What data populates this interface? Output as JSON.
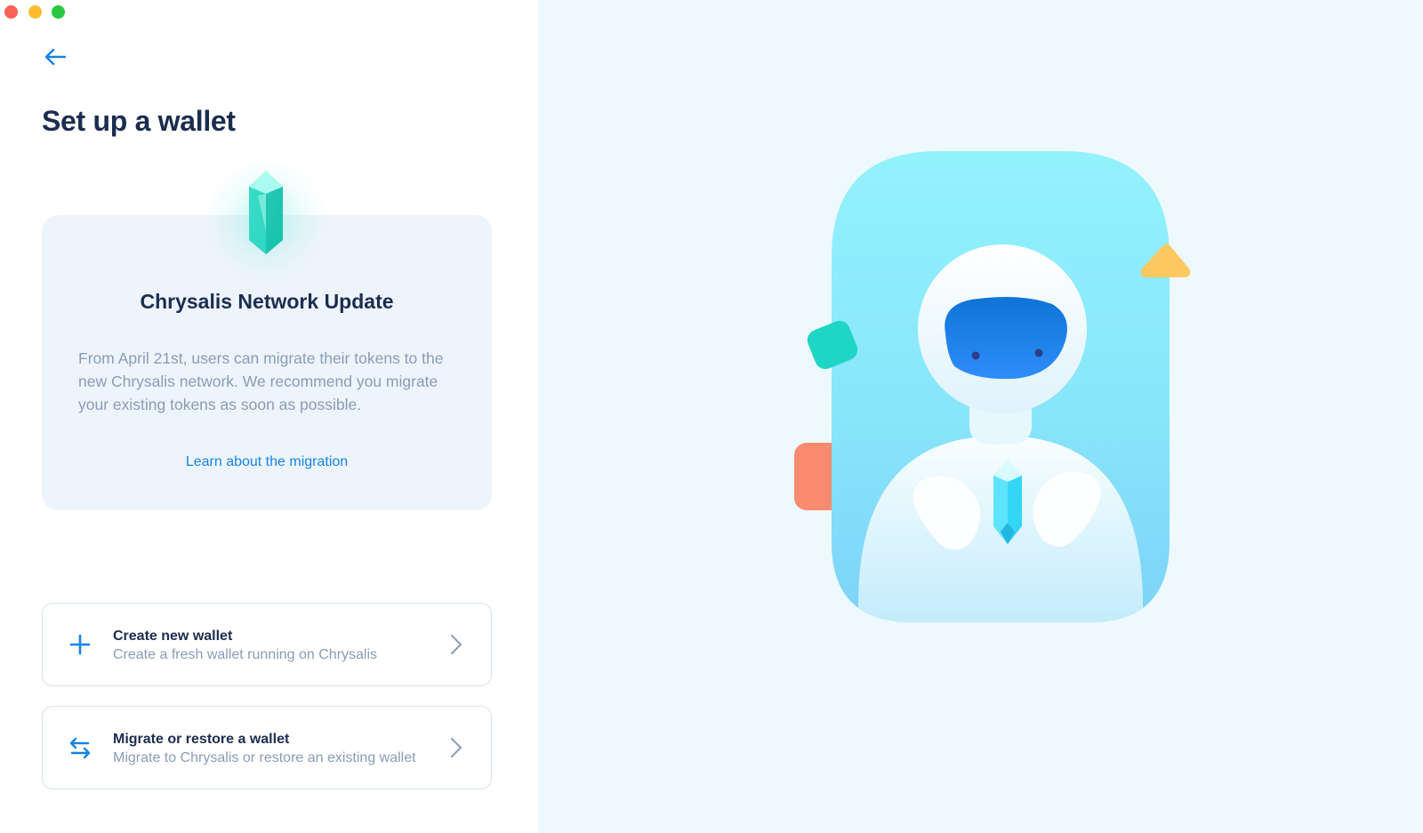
{
  "window": {
    "controls": [
      "close",
      "minimize",
      "zoom"
    ]
  },
  "header": {
    "back_icon": "arrow-left-icon",
    "title": "Set up a wallet"
  },
  "update_card": {
    "icon": "crystal-icon",
    "title": "Chrysalis Network Update",
    "body": "From April 21st, users can migrate their tokens to the new Chrysalis network. We recommend you migrate your existing tokens as soon as possible.",
    "link": "Learn about the migration"
  },
  "options": [
    {
      "icon": "plus-icon",
      "title": "Create new wallet",
      "subtitle": "Create a fresh wallet running on Chrysalis"
    },
    {
      "icon": "transfer-arrows-icon",
      "title": "Migrate or restore a wallet",
      "subtitle": "Migrate to Chrysalis or restore an existing wallet"
    }
  ],
  "colors": {
    "accent": "#1683e8",
    "title": "#1b2d4f",
    "muted": "#8a9cb6",
    "card_bg": "#eef4fb",
    "right_bg": "#eef9fd"
  }
}
